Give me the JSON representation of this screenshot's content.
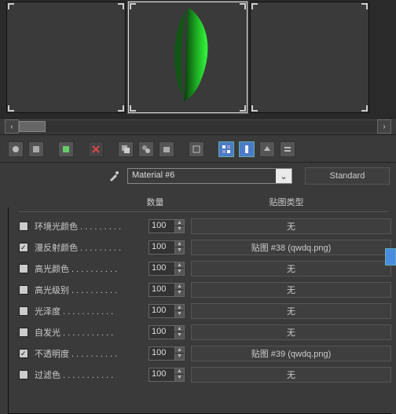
{
  "material_name": "Material #6",
  "type_button": "Standard",
  "headers": {
    "amount": "数量",
    "maptype": "贴图类型"
  },
  "scroll": {
    "left": "‹",
    "right": "›"
  },
  "dropdown_chevron": "⌄",
  "map_none": "无",
  "rows": [
    {
      "checked": false,
      "label": "环境光颜色 . . . . . . . . .",
      "value": "100",
      "map": "无"
    },
    {
      "checked": true,
      "label": "漫反射颜色 . . . . . . . . .",
      "value": "100",
      "map": "贴图 #38 (qwdq.png)"
    },
    {
      "checked": false,
      "label": "高光颜色 . . . . . . . . . .",
      "value": "100",
      "map": "无"
    },
    {
      "checked": false,
      "label": "高光级别 . . . . . . . . . .",
      "value": "100",
      "map": "无"
    },
    {
      "checked": false,
      "label": "光泽度 . . . . . . . . . . .",
      "value": "100",
      "map": "无"
    },
    {
      "checked": false,
      "label": "自发光 . . . . . . . . . . .",
      "value": "100",
      "map": "无"
    },
    {
      "checked": true,
      "label": "不透明度 . . . . . . . . . .",
      "value": "100",
      "map": "贴图 #39 (qwdq.png)"
    },
    {
      "checked": false,
      "label": "过滤色 . . . . . . . . . . .",
      "value": "100",
      "map": "无"
    }
  ]
}
